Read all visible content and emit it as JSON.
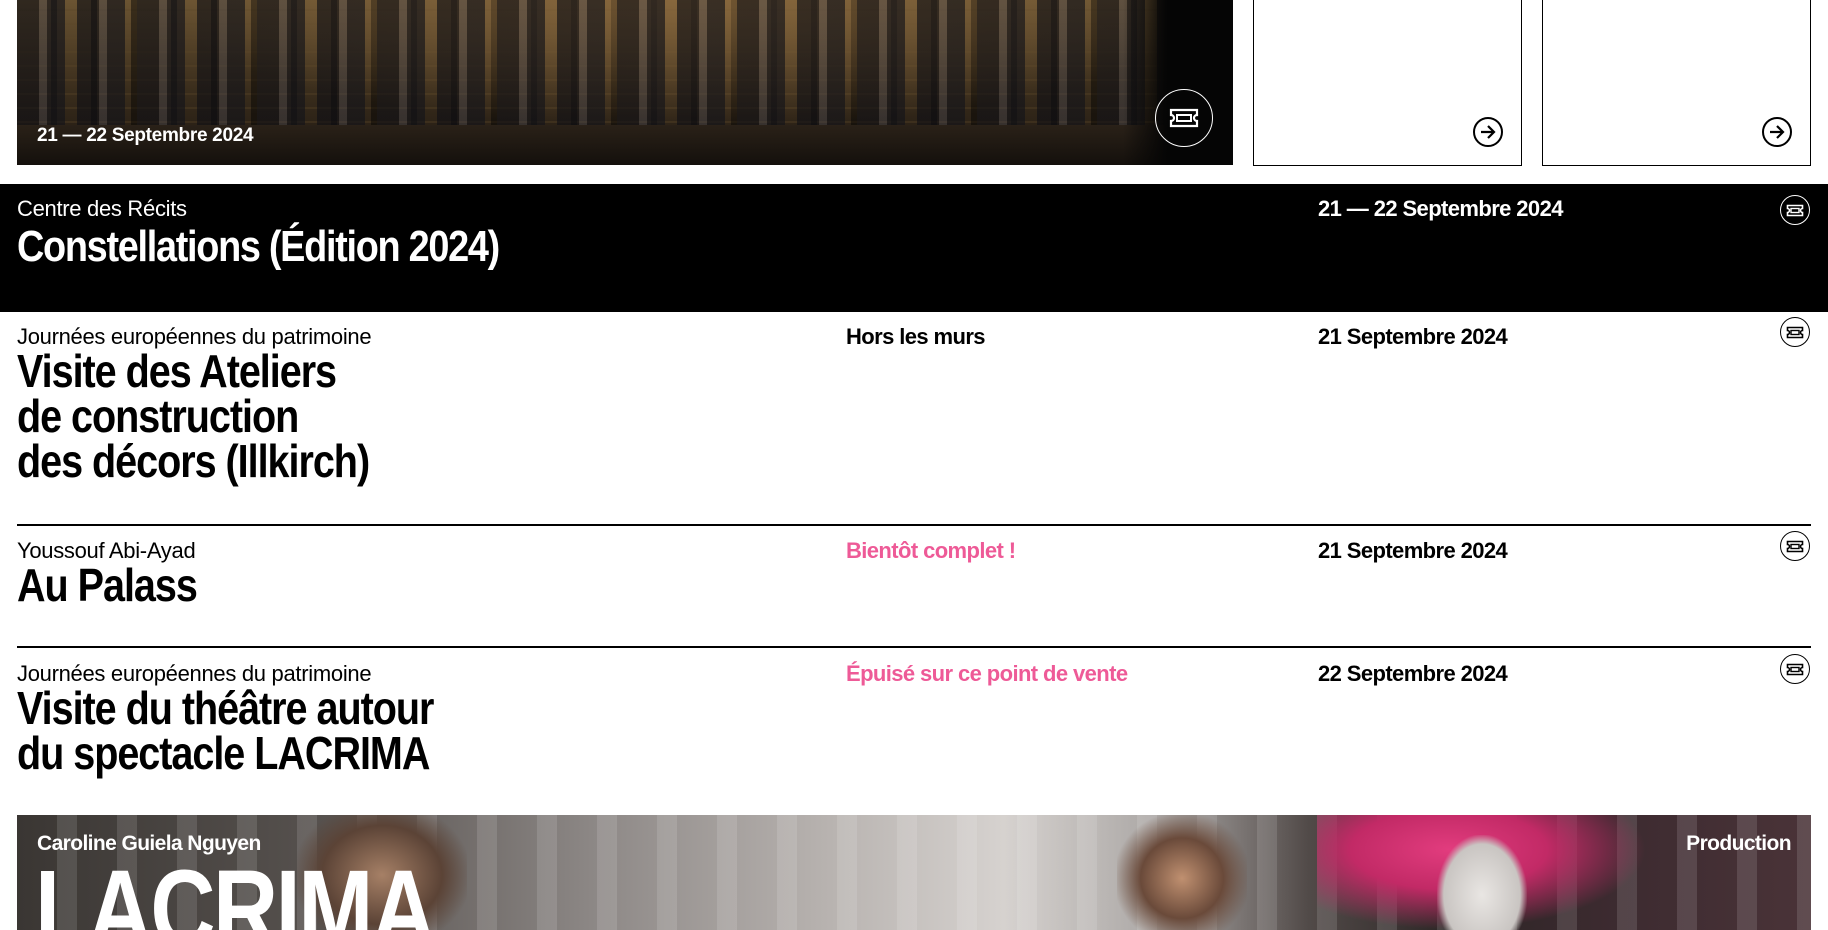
{
  "hero": {
    "date": "21 — 22 Septembre 2024",
    "ticket_icon": "ticket-icon"
  },
  "cards": [
    {
      "arrow_icon": "arrow-right-icon"
    },
    {
      "arrow_icon": "arrow-right-icon"
    }
  ],
  "featured": {
    "subtitle": "Centre des Récits",
    "title": "Constellations (Édition 2024)",
    "date": "21 — 22 Septembre 2024",
    "ticket_icon": "ticket-icon"
  },
  "events": [
    {
      "subtitle": "Journées européennes du patrimoine",
      "title": "Visite des Ateliers\nde construction\ndes décors (Illkirch)",
      "status": "Hors les murs",
      "status_color": "#000000",
      "date": "21 Septembre 2024",
      "ticket_icon": "ticket-icon"
    },
    {
      "subtitle": "Youssouf Abi-Ayad",
      "title": "Au Palass",
      "status": "Bientôt complet !",
      "status_color": "#ee5a97",
      "date": "21 Septembre 2024",
      "ticket_icon": "ticket-icon"
    },
    {
      "subtitle": "Journées européennes du patrimoine",
      "title": "Visite du théâtre autour\ndu spectacle LACRIMA",
      "status": "Épuisé sur ce point de vente",
      "status_color": "#ee5a97",
      "date": "22 Septembre 2024",
      "ticket_icon": "ticket-icon"
    }
  ],
  "banner": {
    "author": "Caroline Guiela Nguyen",
    "title": "LACRIMA",
    "tag": "Production"
  },
  "colors": {
    "accent_pink": "#ee5a97",
    "featured_bg": "#000000"
  }
}
